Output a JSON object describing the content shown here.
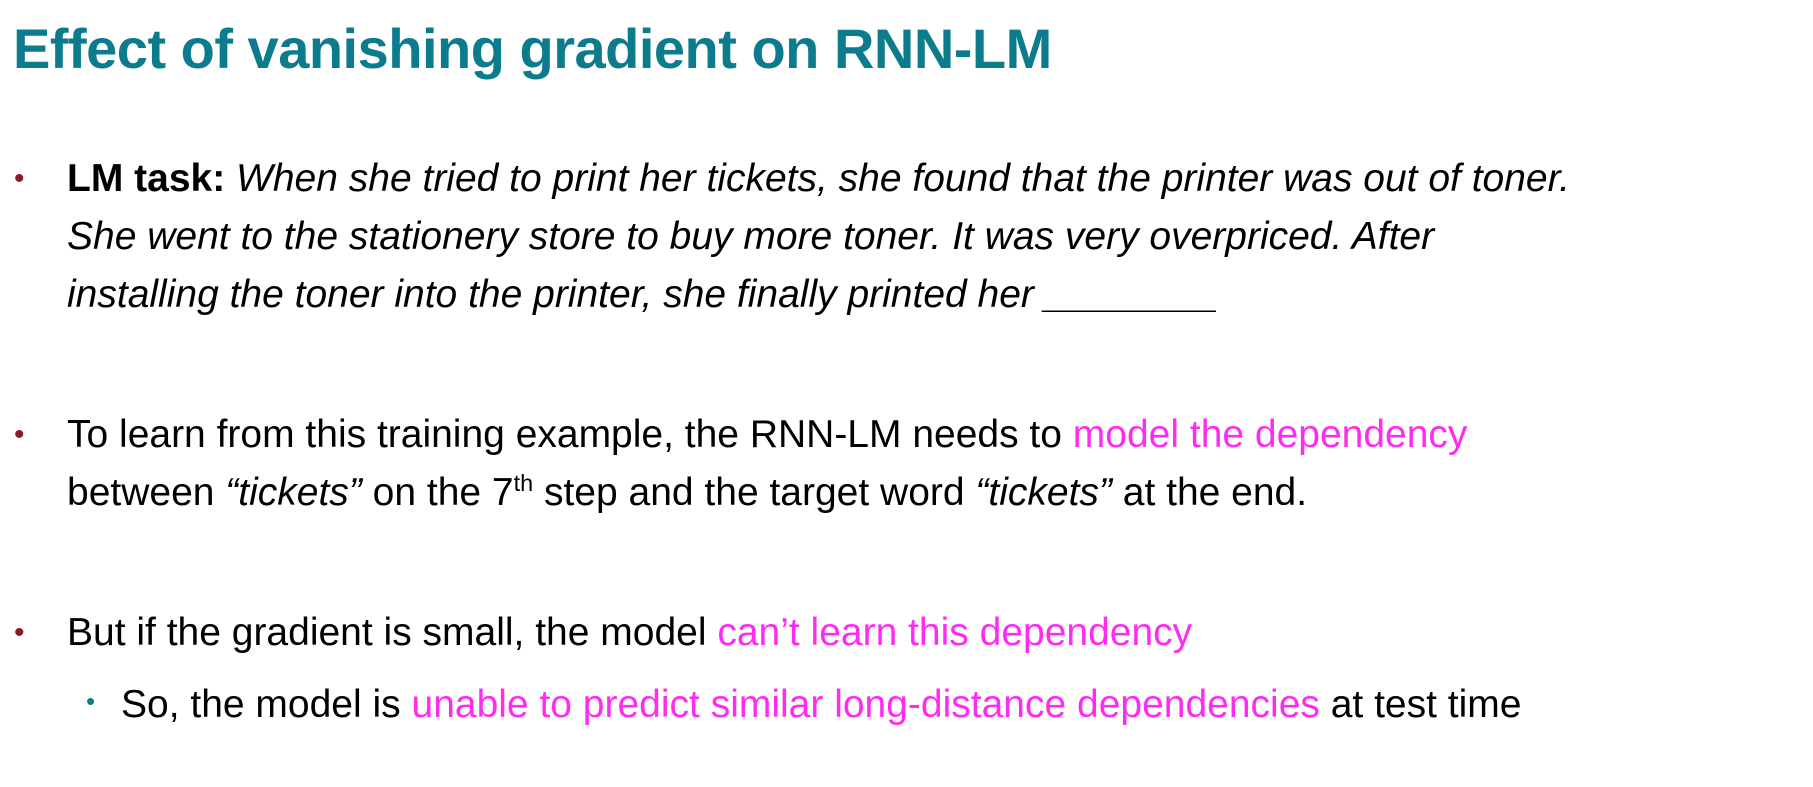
{
  "slide": {
    "title": "Effect of vanishing gradient on RNN-LM",
    "bullet_char": "•",
    "colors": {
      "title": "#0c7b8c",
      "bullet": "#8e1a24",
      "sub_bullet": "#0c7b8c",
      "highlight": "#ff2cf0",
      "text": "#000000"
    }
  },
  "bullets": [
    {
      "label": "LM task:",
      "lines": [
        "When she tried to print her tickets, she found that the printer was out of toner.",
        "She went to the stationery store to buy more toner. It was very overpriced. After",
        "installing the toner into the printer, she finally printed her ________"
      ]
    },
    {
      "line1_a": "To learn from this training example, the RNN-LM needs to",
      "line1_highlight": "model the dependency",
      "line2_a": "between",
      "quote1": "“tickets”",
      "line2_b": "on the 7",
      "sup": "th",
      "line2_c": "step and the target word",
      "quote2": "“tickets”",
      "line2_d": "at the end."
    },
    {
      "text_a": "But if the gradient is small, the model",
      "highlight": "can’t learn this dependency",
      "sub": {
        "text_a": "So, the model is",
        "highlight": "unable to predict similar long-distance dependencies",
        "text_b": "at test time"
      }
    }
  ]
}
